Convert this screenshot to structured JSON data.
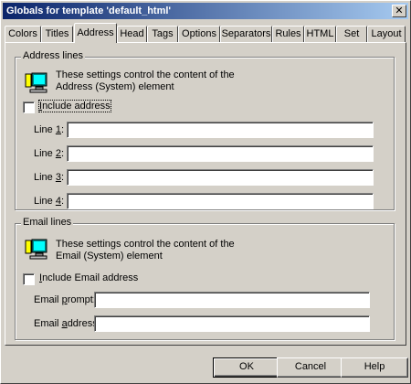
{
  "window": {
    "title": "Globals for template 'default_html'",
    "close_glyph": "✕"
  },
  "tabs": [
    {
      "label": "Colors"
    },
    {
      "label": "Titles"
    },
    {
      "label": "Address",
      "active": true
    },
    {
      "label": "Head"
    },
    {
      "label": "Tags"
    },
    {
      "label": "Options"
    },
    {
      "label": "Separators"
    },
    {
      "label": "Rules"
    },
    {
      "label": "HTML"
    },
    {
      "label": "Set"
    },
    {
      "label": "Layout"
    }
  ],
  "address_group": {
    "title": "Address lines",
    "info_line1": "These settings control the content of the",
    "info_line2": "Address (System) element",
    "include_label_key": "I",
    "include_label_rest": "nclude address",
    "include_checked": false,
    "lines": [
      {
        "label_pre": "Line ",
        "label_key": "1",
        "label_post": ":",
        "value": ""
      },
      {
        "label_pre": "Line ",
        "label_key": "2",
        "label_post": ":",
        "value": ""
      },
      {
        "label_pre": "Line ",
        "label_key": "3",
        "label_post": ":",
        "value": ""
      },
      {
        "label_pre": "Line ",
        "label_key": "4",
        "label_post": ":",
        "value": ""
      }
    ]
  },
  "email_group": {
    "title": "Email lines",
    "info_line1": "These settings control the content of the",
    "info_line2": "Email (System) element",
    "include_label_key": "I",
    "include_label_rest": "nclude Email address",
    "include_checked": false,
    "prompt_label_pre": "Email ",
    "prompt_label_key": "p",
    "prompt_label_post": "rompt:",
    "prompt_value": "",
    "address_label_pre": "Email ",
    "address_label_key": "a",
    "address_label_post": "ddress:",
    "address_value": ""
  },
  "buttons": {
    "ok": "OK",
    "cancel": "Cancel",
    "help": "Help"
  },
  "colors": {
    "titlebar_start": "#0a246a",
    "titlebar_end": "#a6caf0",
    "face": "#d4d0c8"
  }
}
